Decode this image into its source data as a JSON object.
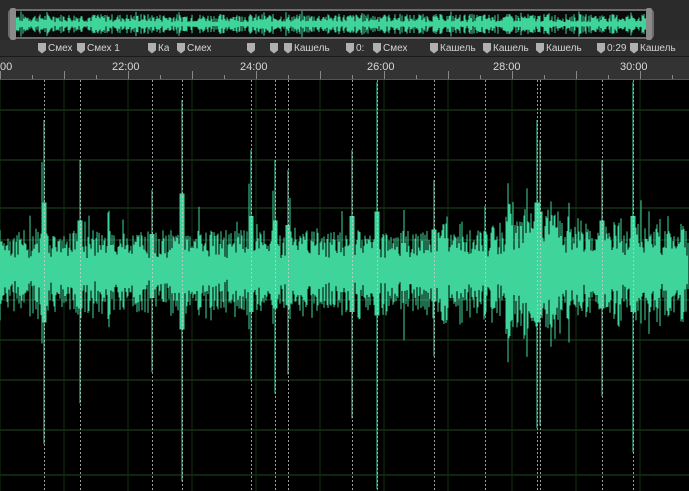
{
  "overview": {
    "label": "overview-navigator"
  },
  "markers": [
    {
      "label": "Смех"
    },
    {
      "label": "Смех 1"
    },
    {
      "label": "Ка"
    },
    {
      "label": "Смех"
    },
    {
      "label": ""
    },
    {
      "label": ""
    },
    {
      "label": "Кашель"
    },
    {
      "label": "0:"
    },
    {
      "label": "Смех"
    },
    {
      "label": "Кашель"
    },
    {
      "label": "Кашель"
    },
    {
      "label": "Кашель"
    },
    {
      "label": "0:29"
    },
    {
      "label": "Кашель"
    }
  ],
  "ruler": {
    "labels": [
      "00",
      "22:00",
      "24:00",
      "26:00",
      "28:00",
      "30:00"
    ]
  },
  "colors": {
    "waveform": "#3fd49a",
    "grid": "#1f4a1f",
    "marker_line": "#cfcfcf"
  }
}
